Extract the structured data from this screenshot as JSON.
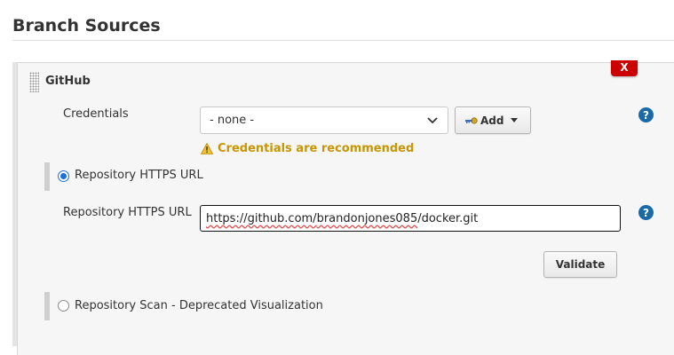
{
  "section": {
    "title": "Branch Sources"
  },
  "source": {
    "title": "GitHub",
    "delete_label": "X",
    "credentials": {
      "label": "Credentials",
      "selected": "- none -",
      "add_label": "Add",
      "warning": "Credentials are recommended",
      "help_label": "?"
    },
    "options": [
      {
        "label": "Repository HTTPS URL",
        "selected": true
      },
      {
        "label": "Repository Scan - Deprecated Visualization",
        "selected": false
      }
    ],
    "repository_url": {
      "label": "Repository HTTPS URL",
      "value": "https://github.com/brandonjones085/docker.git",
      "value_parts": [
        "https://github.com/",
        "brandonjones085",
        "/docker.git"
      ],
      "help_label": "?"
    },
    "validate_label": "Validate"
  },
  "colors": {
    "delete": "#cc0000",
    "warning": "#c79600",
    "help": "#1a6aa8",
    "radio_selected": "#1e6fd9"
  }
}
